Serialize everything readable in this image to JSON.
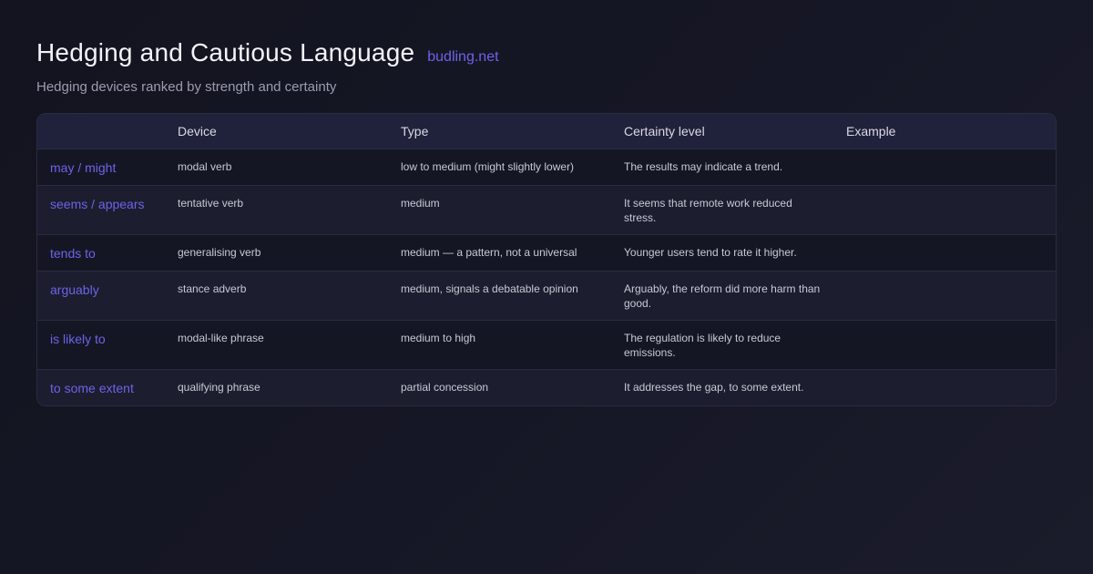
{
  "header": {
    "title": "Hedging and Cautious Language",
    "site": "budling.net",
    "subtitle": "Hedging devices ranked by strength and certainty"
  },
  "table": {
    "columns": [
      "",
      "Device",
      "Type",
      "Certainty level",
      "Example"
    ],
    "rows": [
      {
        "label": "may / might",
        "device": "modal verb",
        "type": "low to medium (might slightly lower)",
        "certainty": "The results may indicate a trend.",
        "example": ""
      },
      {
        "label": "seems / appears",
        "device": "tentative verb",
        "type": "medium",
        "certainty": "It seems that remote work reduced stress.",
        "example": ""
      },
      {
        "label": "tends to",
        "device": "generalising verb",
        "type": "medium — a pattern, not a universal",
        "certainty": "Younger users tend to rate it higher.",
        "example": ""
      },
      {
        "label": "arguably",
        "device": "stance adverb",
        "type": "medium, signals a debatable opinion",
        "certainty": "Arguably, the reform did more harm than good.",
        "example": ""
      },
      {
        "label": "is likely to",
        "device": "modal-like phrase",
        "type": "medium to high",
        "certainty": "The regulation is likely to reduce emissions.",
        "example": ""
      },
      {
        "label": "to some extent",
        "device": "qualifying phrase",
        "type": "partial concession",
        "certainty": "It addresses the gap, to some extent.",
        "example": ""
      }
    ]
  },
  "colors": {
    "accent": "#6d63e8",
    "background": "#13141f",
    "header_row": "#20213a"
  }
}
